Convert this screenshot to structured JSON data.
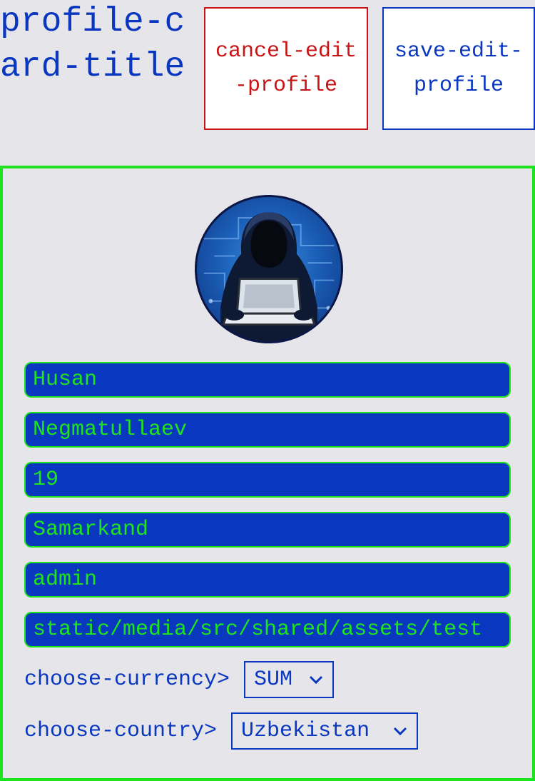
{
  "header": {
    "title": "profile-card-title",
    "cancel_label": "cancel-edit-profile",
    "save_label": "save-edit-profile"
  },
  "card": {
    "avatar_icon": "hacker-avatar-icon",
    "fields": {
      "first_name": "Husan",
      "last_name": "Negmatullaev",
      "age": "19",
      "city": "Samarkand",
      "role": "admin",
      "image_path": "static/media/src/shared/assets/test"
    },
    "currency": {
      "label": "choose-currency>",
      "selected": "SUM"
    },
    "country": {
      "label": "choose-country>",
      "selected": "Uzbekistan"
    }
  },
  "colors": {
    "primary": "#0a37c0",
    "accent": "#1ee31e",
    "danger": "#c81414",
    "background": "#e6e6ea"
  }
}
